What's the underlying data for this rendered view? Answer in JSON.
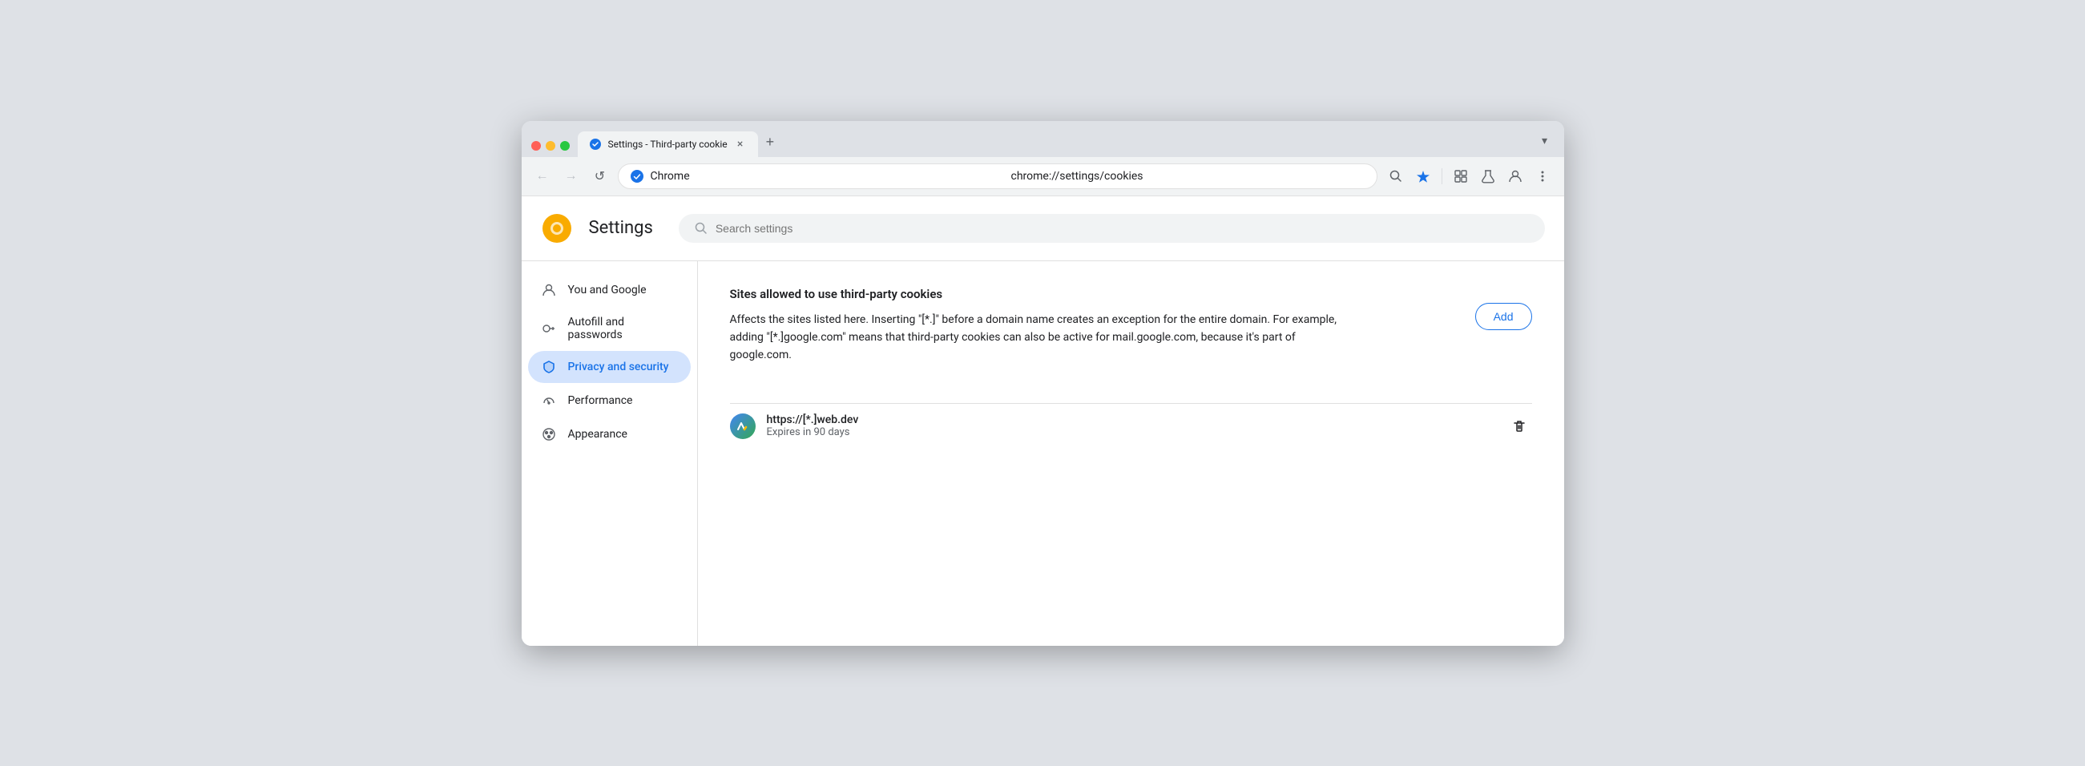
{
  "browser": {
    "tab_title": "Settings - Third-party cookie",
    "new_tab_label": "+",
    "chevron_label": "▾"
  },
  "toolbar": {
    "back_label": "←",
    "forward_label": "→",
    "refresh_label": "↺",
    "address": "chrome://settings/cookies",
    "chrome_label": "Chrome",
    "search_icon_label": "🔍",
    "star_icon_label": "★",
    "extensions_icon_label": "⊡",
    "labs_icon_label": "⚗",
    "profile_icon_label": "👤",
    "menu_icon_label": "⋮"
  },
  "settings": {
    "logo_title": "Settings",
    "search_placeholder": "Search settings"
  },
  "sidebar": {
    "items": [
      {
        "id": "you-and-google",
        "label": "You and Google",
        "icon": "person"
      },
      {
        "id": "autofill",
        "label": "Autofill and passwords",
        "icon": "key"
      },
      {
        "id": "privacy",
        "label": "Privacy and security",
        "icon": "shield",
        "active": true
      },
      {
        "id": "performance",
        "label": "Performance",
        "icon": "speedometer"
      },
      {
        "id": "appearance",
        "label": "Appearance",
        "icon": "palette"
      }
    ]
  },
  "content": {
    "section_title": "Sites allowed to use third-party cookies",
    "description": "Affects the sites listed here. Inserting \"[*.]\" before a domain name creates an exception for the entire domain. For example, adding \"[*.]google.com\" means that third-party cookies can also be active for mail.google.com, because it's part of google.com.",
    "add_button_label": "Add",
    "cookie_entry": {
      "url": "https://[*.]web.dev",
      "expires": "Expires in 90 days",
      "delete_label": "🗑"
    }
  }
}
